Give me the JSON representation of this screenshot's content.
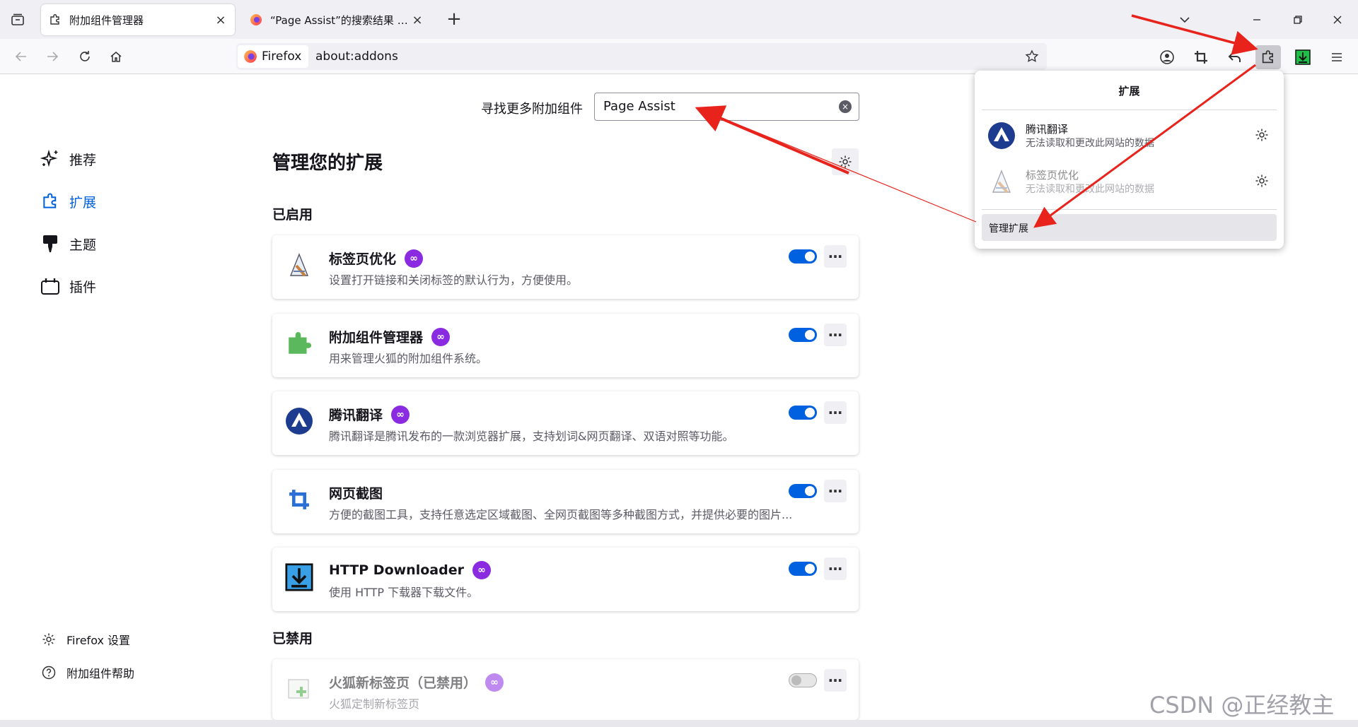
{
  "tabs": [
    {
      "title": "附加组件管理器",
      "icon": "puzzle-icon"
    },
    {
      "title": "“Page Assist”的搜索结果 – Firefox",
      "icon": "firefox-icon"
    }
  ],
  "navbar": {
    "identity_label": "Firefox",
    "url": "about:addons"
  },
  "sidebar": {
    "categories": [
      {
        "label": "推荐",
        "icon": "sparkle-icon"
      },
      {
        "label": "扩展",
        "icon": "puzzle-icon"
      },
      {
        "label": "主题",
        "icon": "brush-icon"
      },
      {
        "label": "插件",
        "icon": "plugin-icon"
      }
    ],
    "footer": [
      {
        "label": "Firefox 设置",
        "icon": "gear-icon"
      },
      {
        "label": "附加组件帮助",
        "icon": "help-icon"
      }
    ]
  },
  "main": {
    "search_label": "寻找更多附加组件",
    "search_value": "Page Assist",
    "title": "管理您的扩展",
    "enabled_heading": "已启用",
    "disabled_heading": "已禁用",
    "enabled": [
      {
        "name": "标签页优化",
        "desc": "设置打开链接和关闭标签的默认行为，方便使用。"
      },
      {
        "name": "附加组件管理器",
        "desc": "用来管理火狐的附加组件系统。"
      },
      {
        "name": "腾讯翻译",
        "desc": "腾讯翻译是腾讯发布的一款浏览器扩展，支持划词&网页翻译、双语对照等功能。"
      },
      {
        "name": "网页截图",
        "desc": "方便的截图工具，支持任意选定区域截图、全网页截图等多种截图方式，并提供必要的图片..."
      },
      {
        "name": "HTTP Downloader",
        "desc": "使用 HTTP 下载器下载文件。"
      }
    ],
    "disabled": [
      {
        "name": "火狐新标签页（已禁用）",
        "desc": "火狐定制新标签页"
      }
    ]
  },
  "panel": {
    "title": "扩展",
    "items": [
      {
        "name": "腾讯翻译",
        "sub": "无法读取和更改此网站的数据"
      },
      {
        "name": "标签页优化",
        "sub": "无法读取和更改此网站的数据"
      }
    ],
    "manage": "管理扩展"
  },
  "watermark": "CSDN @正经教主",
  "colors": {
    "accent": "#0061e0",
    "badge": "#8a2be2",
    "arrow": "#e8231c"
  }
}
